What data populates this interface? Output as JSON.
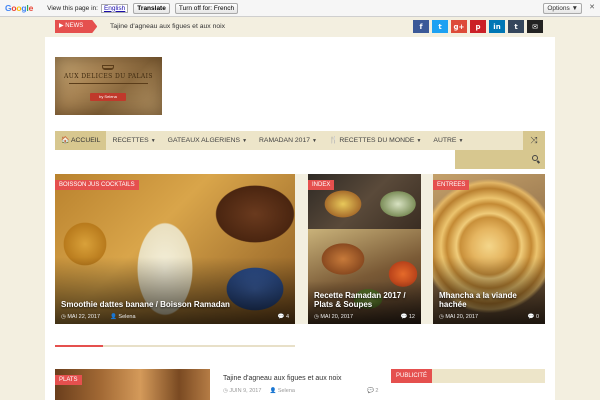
{
  "translate_bar": {
    "logo_letters": [
      "G",
      "o",
      "o",
      "g",
      "l",
      "e"
    ],
    "prompt": "View this page in:",
    "language": "English",
    "translate_label": "Translate",
    "turn_off_label": "Turn off for: French",
    "options_label": "Options ▼",
    "close_label": "✕"
  },
  "topbar": {
    "news_label": "▶ NEWS",
    "ticker_text": "Tajine d'agneau aux figues et aux noix",
    "social": [
      {
        "icon": "facebook-icon",
        "glyph": "f",
        "color": "#3b5998"
      },
      {
        "icon": "twitter-icon",
        "glyph": "t",
        "color": "#1da1f2"
      },
      {
        "icon": "google-plus-icon",
        "glyph": "g+",
        "color": "#dd4b39"
      },
      {
        "icon": "pinterest-icon",
        "glyph": "p",
        "color": "#cb2027"
      },
      {
        "icon": "linkedin-icon",
        "glyph": "in",
        "color": "#0077b5"
      },
      {
        "icon": "tumblr-icon",
        "glyph": "t",
        "color": "#35465c"
      },
      {
        "icon": "mail-icon",
        "glyph": "✉",
        "color": "#222222"
      }
    ]
  },
  "logo": {
    "text": "AUX DELICES DU PALAIS",
    "button": "by Selena"
  },
  "nav": {
    "items": [
      {
        "label": "🏠 Accueil",
        "has_caret": false
      },
      {
        "label": "Recettes",
        "has_caret": true
      },
      {
        "label": "Gateaux Algeriens",
        "has_caret": true
      },
      {
        "label": "Ramadan 2017",
        "has_caret": true
      },
      {
        "label": "🍴 Recettes du monde",
        "has_caret": true
      },
      {
        "label": "Autre",
        "has_caret": true
      }
    ],
    "shuffle_glyph": "⤨"
  },
  "featured": [
    {
      "tag": "Boisson jus cocktails",
      "title": "Smoothie dattes banane / Boisson Ramadan",
      "date": "◷ MAI 22, 2017",
      "author": "👤 Selena",
      "comments": "💬 4"
    },
    {
      "tag": "Index",
      "title": "",
      "date": "",
      "author": "",
      "comments": ""
    },
    {
      "tag": "",
      "title": "Recette Ramadan 2017 / Plats & Soupes",
      "date": "◷ MAI 20, 2017",
      "author": "",
      "comments": "💬 12"
    },
    {
      "tag": "Entrees",
      "title": "Mhancha a la viande hachée",
      "date": "◷ MAI 20, 2017",
      "author": "",
      "comments": "💬 0"
    }
  ],
  "slider_progress": 0.2,
  "bottom": {
    "card_tag": "Plats",
    "title": "Tajine d'agneau aux figues et aux noix",
    "date": "◷ JUIN 9, 2017",
    "author": "👤 Selena",
    "comments": "💬 2",
    "sidebar_label": "Publicité"
  }
}
